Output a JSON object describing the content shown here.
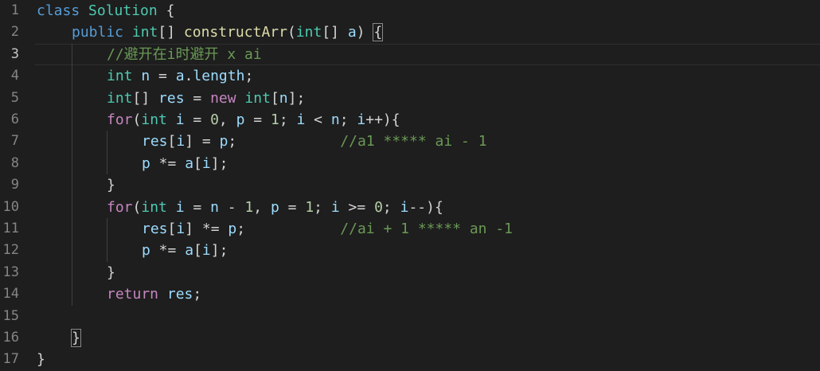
{
  "editor": {
    "colors": {
      "background": "#1e1e1e",
      "keyword": "#569cd6",
      "control": "#c586c0",
      "type": "#4ec9b0",
      "function": "#dcdcaa",
      "variable": "#9cdcfe",
      "number": "#b5cea8",
      "comment": "#6a9955",
      "text": "#d4d4d4",
      "line_number": "#858585"
    },
    "current_line": 3,
    "lines": [
      {
        "n": "1",
        "indent": 0,
        "tokens": [
          {
            "t": "class",
            "c": "keyword"
          },
          {
            "t": " "
          },
          {
            "t": "Solution",
            "c": "type"
          },
          {
            "t": " {",
            "c": "punct"
          }
        ]
      },
      {
        "n": "2",
        "indent": 1,
        "tokens": [
          {
            "t": "public",
            "c": "keyword"
          },
          {
            "t": " "
          },
          {
            "t": "int",
            "c": "type"
          },
          {
            "t": "[] ",
            "c": "punct"
          },
          {
            "t": "constructArr",
            "c": "func"
          },
          {
            "t": "(",
            "c": "punct"
          },
          {
            "t": "int",
            "c": "type"
          },
          {
            "t": "[] ",
            "c": "punct"
          },
          {
            "t": "a",
            "c": "var"
          },
          {
            "t": ") ",
            "c": "punct"
          },
          {
            "t": "{",
            "c": "punct",
            "match": true
          }
        ]
      },
      {
        "n": "3",
        "indent": 2,
        "tokens": [
          {
            "t": "//避开在i时避开 x ai",
            "c": "comment"
          }
        ]
      },
      {
        "n": "4",
        "indent": 2,
        "tokens": [
          {
            "t": "int",
            "c": "type"
          },
          {
            "t": " "
          },
          {
            "t": "n",
            "c": "var"
          },
          {
            "t": " = ",
            "c": "punct"
          },
          {
            "t": "a",
            "c": "var"
          },
          {
            "t": ".",
            "c": "punct"
          },
          {
            "t": "length",
            "c": "var"
          },
          {
            "t": ";",
            "c": "punct"
          }
        ]
      },
      {
        "n": "5",
        "indent": 2,
        "tokens": [
          {
            "t": "int",
            "c": "type"
          },
          {
            "t": "[] ",
            "c": "punct"
          },
          {
            "t": "res",
            "c": "var"
          },
          {
            "t": " = ",
            "c": "punct"
          },
          {
            "t": "new",
            "c": "control"
          },
          {
            "t": " "
          },
          {
            "t": "int",
            "c": "type"
          },
          {
            "t": "[",
            "c": "punct"
          },
          {
            "t": "n",
            "c": "var"
          },
          {
            "t": "];",
            "c": "punct"
          }
        ]
      },
      {
        "n": "6",
        "indent": 2,
        "tokens": [
          {
            "t": "for",
            "c": "control"
          },
          {
            "t": "(",
            "c": "punct"
          },
          {
            "t": "int",
            "c": "type"
          },
          {
            "t": " "
          },
          {
            "t": "i",
            "c": "var"
          },
          {
            "t": " = ",
            "c": "punct"
          },
          {
            "t": "0",
            "c": "number"
          },
          {
            "t": ", ",
            "c": "punct"
          },
          {
            "t": "p",
            "c": "var"
          },
          {
            "t": " = ",
            "c": "punct"
          },
          {
            "t": "1",
            "c": "number"
          },
          {
            "t": "; ",
            "c": "punct"
          },
          {
            "t": "i",
            "c": "var"
          },
          {
            "t": " < ",
            "c": "punct"
          },
          {
            "t": "n",
            "c": "var"
          },
          {
            "t": "; ",
            "c": "punct"
          },
          {
            "t": "i",
            "c": "var"
          },
          {
            "t": "++){",
            "c": "punct"
          }
        ]
      },
      {
        "n": "7",
        "indent": 3,
        "tokens": [
          {
            "t": "res",
            "c": "var"
          },
          {
            "t": "[",
            "c": "punct"
          },
          {
            "t": "i",
            "c": "var"
          },
          {
            "t": "] = ",
            "c": "punct"
          },
          {
            "t": "p",
            "c": "var"
          },
          {
            "t": ";            ",
            "c": "punct"
          },
          {
            "t": "//a1 ***** ai - 1",
            "c": "comment"
          }
        ]
      },
      {
        "n": "8",
        "indent": 3,
        "tokens": [
          {
            "t": "p",
            "c": "var"
          },
          {
            "t": " *= ",
            "c": "punct"
          },
          {
            "t": "a",
            "c": "var"
          },
          {
            "t": "[",
            "c": "punct"
          },
          {
            "t": "i",
            "c": "var"
          },
          {
            "t": "];",
            "c": "punct"
          }
        ]
      },
      {
        "n": "9",
        "indent": 2,
        "tokens": [
          {
            "t": "}",
            "c": "punct"
          }
        ]
      },
      {
        "n": "10",
        "indent": 2,
        "tokens": [
          {
            "t": "for",
            "c": "control"
          },
          {
            "t": "(",
            "c": "punct"
          },
          {
            "t": "int",
            "c": "type"
          },
          {
            "t": " "
          },
          {
            "t": "i",
            "c": "var"
          },
          {
            "t": " = ",
            "c": "punct"
          },
          {
            "t": "n",
            "c": "var"
          },
          {
            "t": " - ",
            "c": "punct"
          },
          {
            "t": "1",
            "c": "number"
          },
          {
            "t": ", ",
            "c": "punct"
          },
          {
            "t": "p",
            "c": "var"
          },
          {
            "t": " = ",
            "c": "punct"
          },
          {
            "t": "1",
            "c": "number"
          },
          {
            "t": "; ",
            "c": "punct"
          },
          {
            "t": "i",
            "c": "var"
          },
          {
            "t": " >= ",
            "c": "punct"
          },
          {
            "t": "0",
            "c": "number"
          },
          {
            "t": "; ",
            "c": "punct"
          },
          {
            "t": "i",
            "c": "var"
          },
          {
            "t": "--){",
            "c": "punct"
          }
        ]
      },
      {
        "n": "11",
        "indent": 3,
        "tokens": [
          {
            "t": "res",
            "c": "var"
          },
          {
            "t": "[",
            "c": "punct"
          },
          {
            "t": "i",
            "c": "var"
          },
          {
            "t": "] *= ",
            "c": "punct"
          },
          {
            "t": "p",
            "c": "var"
          },
          {
            "t": ";           ",
            "c": "punct"
          },
          {
            "t": "//ai + 1 ***** an -1",
            "c": "comment"
          }
        ]
      },
      {
        "n": "12",
        "indent": 3,
        "tokens": [
          {
            "t": "p",
            "c": "var"
          },
          {
            "t": " *= ",
            "c": "punct"
          },
          {
            "t": "a",
            "c": "var"
          },
          {
            "t": "[",
            "c": "punct"
          },
          {
            "t": "i",
            "c": "var"
          },
          {
            "t": "];",
            "c": "punct"
          }
        ]
      },
      {
        "n": "13",
        "indent": 2,
        "tokens": [
          {
            "t": "}",
            "c": "punct"
          }
        ]
      },
      {
        "n": "14",
        "indent": 2,
        "tokens": [
          {
            "t": "return",
            "c": "control"
          },
          {
            "t": " "
          },
          {
            "t": "res",
            "c": "var"
          },
          {
            "t": ";",
            "c": "punct"
          }
        ]
      },
      {
        "n": "15",
        "indent": 0,
        "tokens": []
      },
      {
        "n": "16",
        "indent": 1,
        "tokens": [
          {
            "t": "}",
            "c": "punct",
            "match": true
          }
        ]
      },
      {
        "n": "17",
        "indent": 0,
        "tokens": [
          {
            "t": "}",
            "c": "punct"
          }
        ]
      }
    ]
  }
}
